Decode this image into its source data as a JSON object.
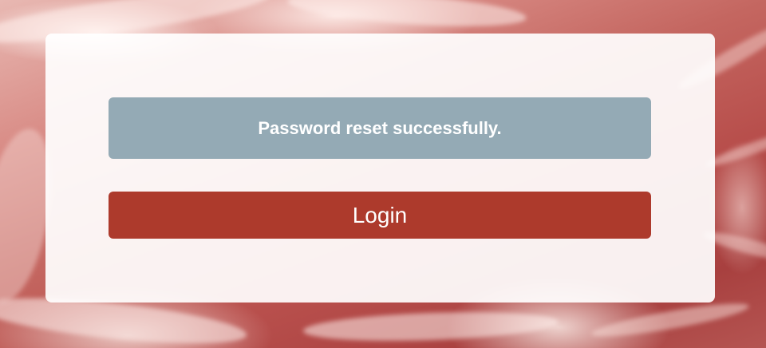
{
  "alert": {
    "message": "Password reset successfully."
  },
  "login_button": {
    "label": "Login"
  },
  "colors": {
    "alert_bg": "#94aab5",
    "button_bg": "#ad3a2c",
    "card_bg": "#ffffff"
  }
}
